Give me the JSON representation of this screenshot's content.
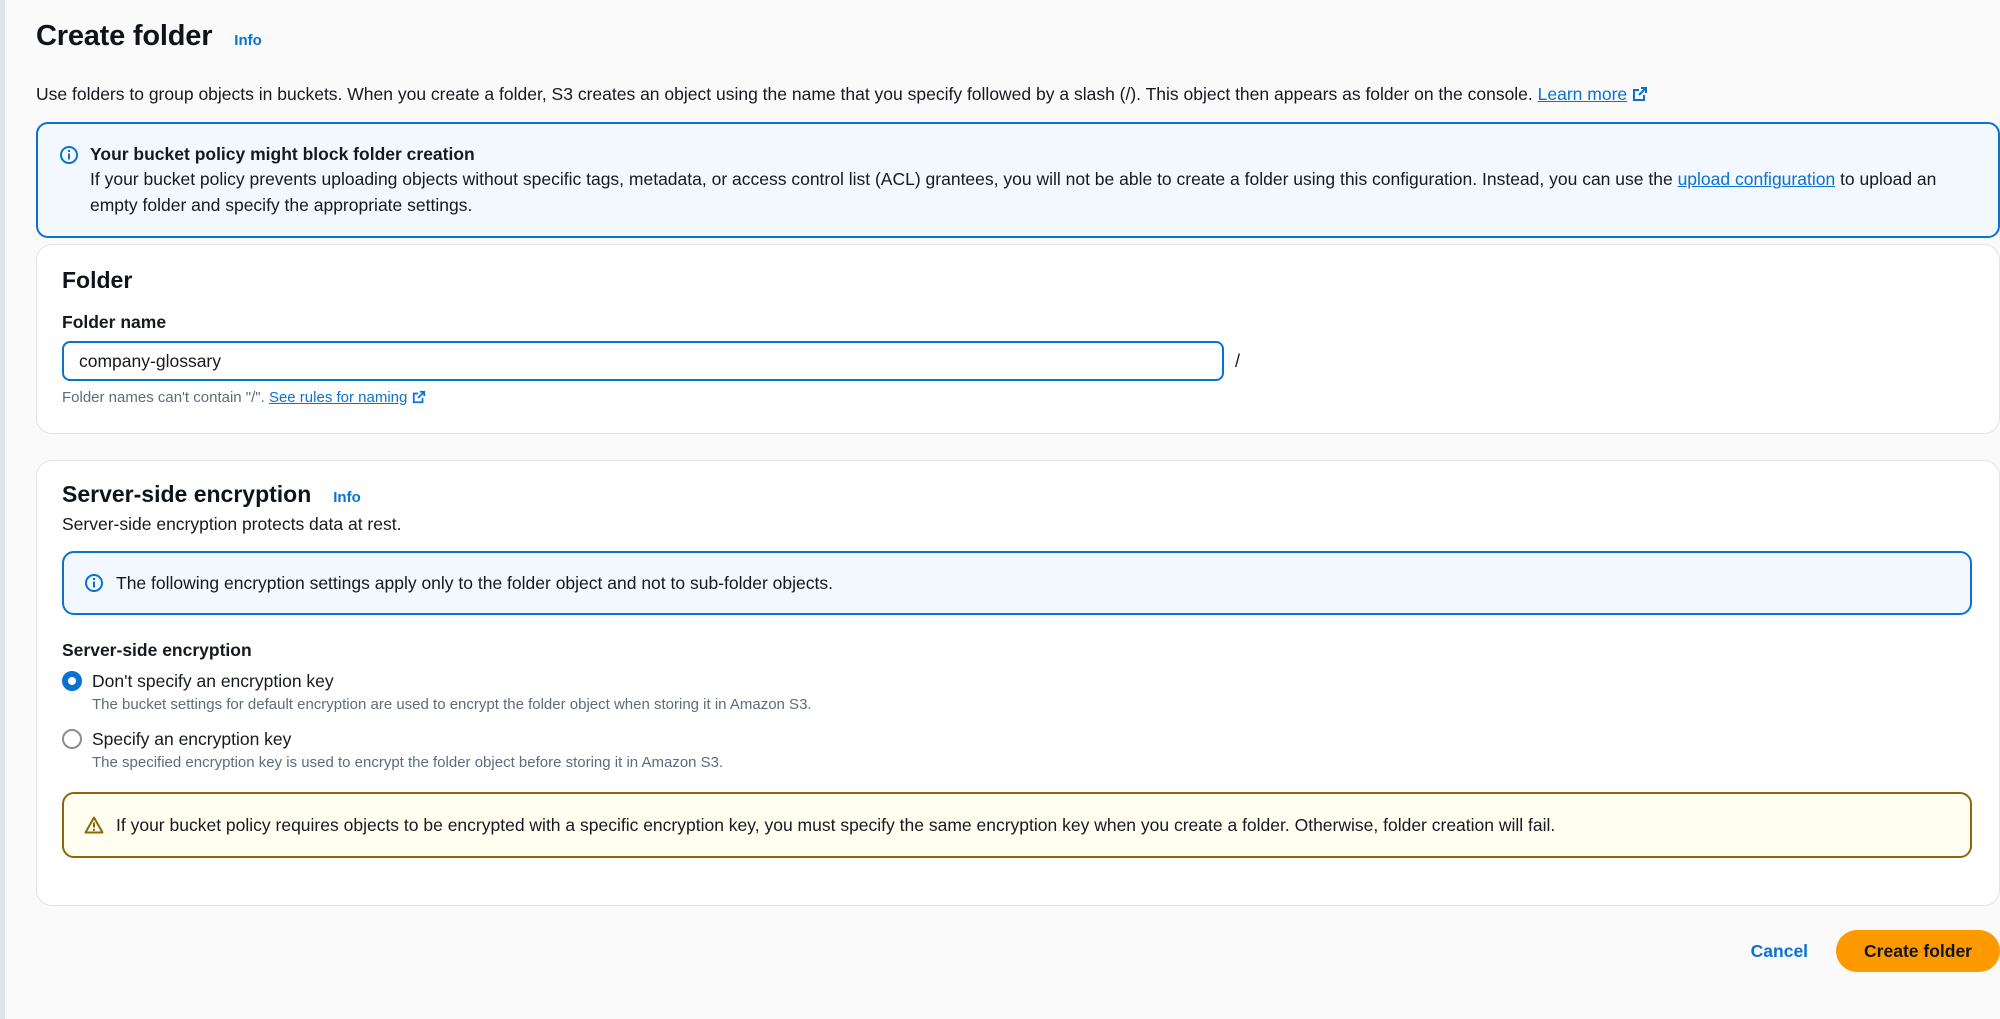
{
  "page": {
    "title": "Create folder",
    "info_label": "Info",
    "description": "Use folders to group objects in buckets. When you create a folder, S3 creates an object using the name that you specify followed by a slash (/). This object then appears as folder on the console.",
    "learn_more_label": "Learn more"
  },
  "policy_alert": {
    "title": "Your bucket policy might block folder creation",
    "body_prefix": "If your bucket policy prevents uploading objects without specific tags, metadata, or access control list (ACL) grantees, you will not be able to create a folder using this configuration. Instead, you can use the",
    "link_label": "upload configuration",
    "body_suffix": "to upload an empty folder and specify the appropriate settings."
  },
  "folder": {
    "section_title": "Folder",
    "field_label": "Folder name",
    "value": "company-glossary",
    "suffix": "/",
    "hint": "Folder names can't contain \"/\".",
    "hint_link_label": "See rules for naming"
  },
  "encryption": {
    "section_title": "Server-side encryption",
    "info_label": "Info",
    "description": "Server-side encryption protects data at rest.",
    "info_alert": "The following encryption settings apply only to the folder object and not to sub-folder objects.",
    "group_label": "Server-side encryption",
    "options": [
      {
        "label": "Don't specify an encryption key",
        "description": "The bucket settings for default encryption are used to encrypt the folder object when storing it in Amazon S3.",
        "selected": true
      },
      {
        "label": "Specify an encryption key",
        "description": "The specified encryption key is used to encrypt the folder object before storing it in Amazon S3.",
        "selected": false
      }
    ],
    "warning": "If your bucket policy requires objects to be encrypted with a specific encryption key, you must specify the same encryption key when you create a folder. Otherwise, folder creation will fail."
  },
  "actions": {
    "cancel_label": "Cancel",
    "create_label": "Create folder"
  },
  "colors": {
    "link": "#0972d3",
    "primary_button": "#ff9900",
    "info_alert_bg": "#f2f8fd",
    "warning_border": "#8d6605"
  }
}
